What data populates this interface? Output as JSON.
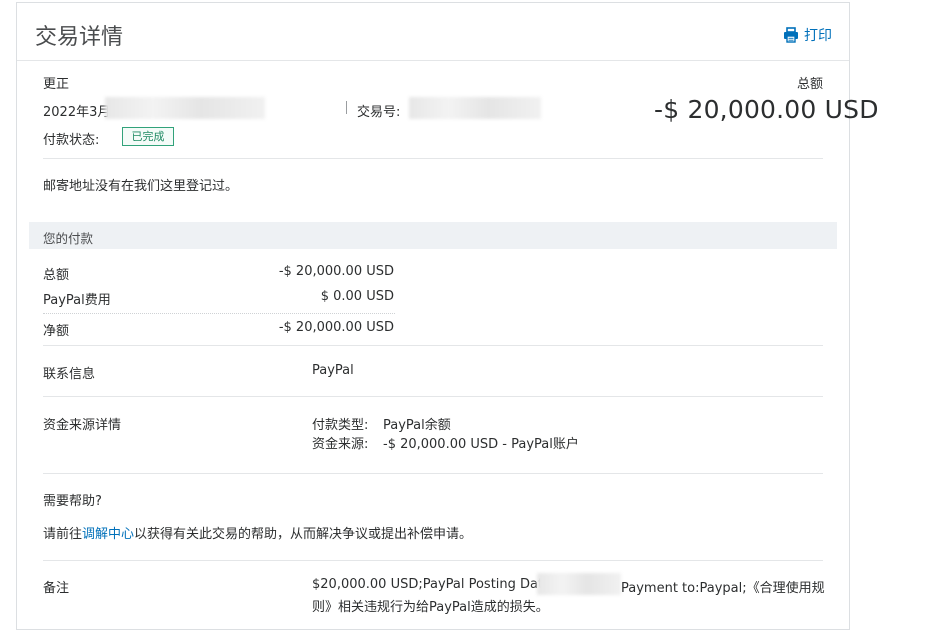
{
  "header": {
    "title": "交易详情",
    "print_label": "打印"
  },
  "summary": {
    "type_label": "更正",
    "date_prefix": "2022年3月",
    "txn_id_label": "交易号:",
    "status_label": "付款状态:",
    "status_value": "已完成",
    "total_label": "总额",
    "total_amount": "-$ 20,000.00 USD"
  },
  "address_note": "邮寄地址没有在我们这里登记过。",
  "payment": {
    "section_title": "您的付款",
    "rows": [
      {
        "label": "总额",
        "value": "-$ 20,000.00 USD"
      },
      {
        "label": "PayPal费用",
        "value": "$ 0.00 USD"
      },
      {
        "label": "净额",
        "value": "-$ 20,000.00 USD"
      }
    ]
  },
  "contact": {
    "label": "联系信息",
    "value": "PayPal"
  },
  "funding": {
    "label": "资金来源详情",
    "type_label": "付款类型:",
    "type_value": "PayPal余额",
    "source_label": "资金来源:",
    "source_value": "-$ 20,000.00 USD - PayPal账户"
  },
  "help": {
    "title": "需要帮助?",
    "text_before": "请前往",
    "link_label": "调解中心",
    "text_after": "以获得有关此交易的帮助，从而解决争议或提出补偿申请。"
  },
  "note": {
    "label": "备注",
    "line1_start": "$20,000.00 USD;PayPal Posting Date",
    "line1_end": "Payment to:Paypal;《合理使用规",
    "line2": "则》相关违规行为给PayPal造成的损失。"
  },
  "colors": {
    "accent": "#0070ba",
    "status_green": "#31a27a",
    "band": "#eef1f4"
  }
}
